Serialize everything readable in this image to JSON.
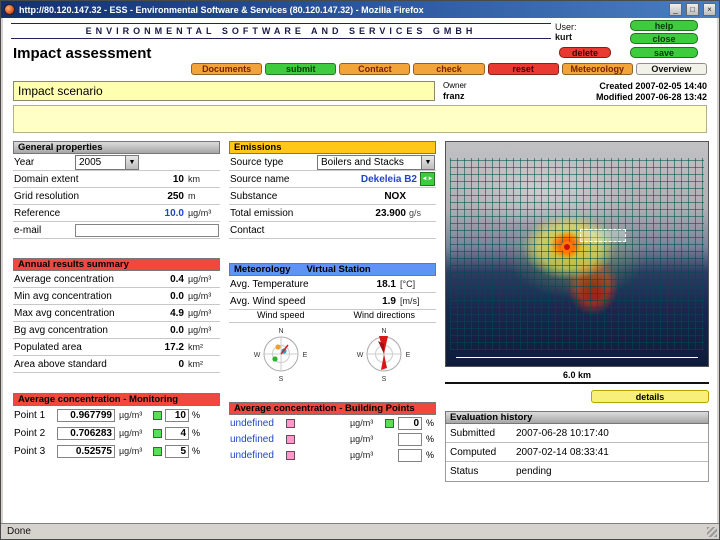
{
  "window": {
    "title": "http://80.120.147.32 - ESS - Environmental Software & Services (80.120.147.32) - Mozilla Firefox",
    "status_text": "Done"
  },
  "masthead": {
    "company": "Environmental Software and Services GmbH",
    "user_label": "User:",
    "user_name": "kurt",
    "help": "help",
    "close": "close",
    "delete": "delete",
    "save": "save"
  },
  "page": {
    "title": "Impact assessment",
    "toolbar": {
      "documents": "Documents",
      "submit": "submit",
      "contact": "Contact",
      "check": "check",
      "reset": "reset",
      "meteorology": "Meteorology",
      "overview": "Overview"
    },
    "scenario": {
      "name": "Impact scenario",
      "owner_label": "Owner",
      "owner": "franz",
      "created": "Created 2007-02-05 14:40",
      "modified": "Modified 2007-06-28 13:42"
    }
  },
  "general": {
    "title": "General properties",
    "year_label": "Year",
    "year_value": "2005",
    "rows": [
      {
        "label": "Domain extent",
        "value": "10",
        "unit": "km"
      },
      {
        "label": "Grid resolution",
        "value": "250",
        "unit": "m"
      },
      {
        "label": "Reference",
        "value": "10.0",
        "unit": "µg/m³"
      }
    ],
    "email_label": "e-mail"
  },
  "annual": {
    "title": "Annual results summary",
    "rows": [
      {
        "label": "Average concentration",
        "value": "0.4",
        "unit": "µg/m³"
      },
      {
        "label": "Min avg concentration",
        "value": "0.0",
        "unit": "µg/m³"
      },
      {
        "label": "Max avg concentration",
        "value": "4.9",
        "unit": "µg/m³"
      },
      {
        "label": "Bg avg concentration",
        "value": "0.0",
        "unit": "µg/m³"
      },
      {
        "label": "Populated area",
        "value": "17.2",
        "unit": "km²"
      },
      {
        "label": "Area above standard",
        "value": "0",
        "unit": "km²"
      }
    ]
  },
  "monitoring": {
    "title": "Average concentration - Monitoring",
    "unit": "µg/m³",
    "percent_sign": "%",
    "rows": [
      {
        "label": "Point 1",
        "value": "0.967799",
        "percent": "10"
      },
      {
        "label": "Point 2",
        "value": "0.706283",
        "percent": "4"
      },
      {
        "label": "Point 3",
        "value": "0.52575",
        "percent": "5"
      }
    ]
  },
  "emissions": {
    "title": "Emissions",
    "source_type_label": "Source type",
    "source_type_value": "Boilers and Stacks",
    "source_name_label": "Source name",
    "source_name_value": "Dekeleia B2",
    "substance_label": "Substance",
    "substance_value": "NOX",
    "total_emission_label": "Total emission",
    "total_emission_value": "23.900",
    "total_emission_unit": "g/s",
    "contact_label": "Contact"
  },
  "meteorology": {
    "title": "Meteorology",
    "subtitle": "Virtual Station",
    "temp_label": "Avg. Temperature",
    "temp_value": "18.1",
    "temp_unit": "[°C]",
    "wind_label": "Avg. Wind speed",
    "wind_value": "1.9",
    "wind_unit": "[m/s]",
    "rose_left_label": "Wind speed",
    "rose_right_label": "Wind directions",
    "compass": {
      "n": "N",
      "e": "E",
      "s": "S",
      "w": "W"
    }
  },
  "building": {
    "title": "Average concentration - Building Points",
    "unit": "µg/m³",
    "percent_sign": "%",
    "rows": [
      {
        "label": "undefined",
        "percent": "0"
      },
      {
        "label": "undefined",
        "percent": ""
      },
      {
        "label": "undefined",
        "percent": ""
      }
    ]
  },
  "map": {
    "scale_label": "6.0 km",
    "details_button": "details"
  },
  "history": {
    "title": "Evaluation history",
    "rows": [
      {
        "label": "Submitted",
        "value": "2007-06-28 10:17:40"
      },
      {
        "label": "Computed",
        "value": "2007-02-14 08:33:41"
      },
      {
        "label": "Status",
        "value": "pending"
      }
    ]
  }
}
